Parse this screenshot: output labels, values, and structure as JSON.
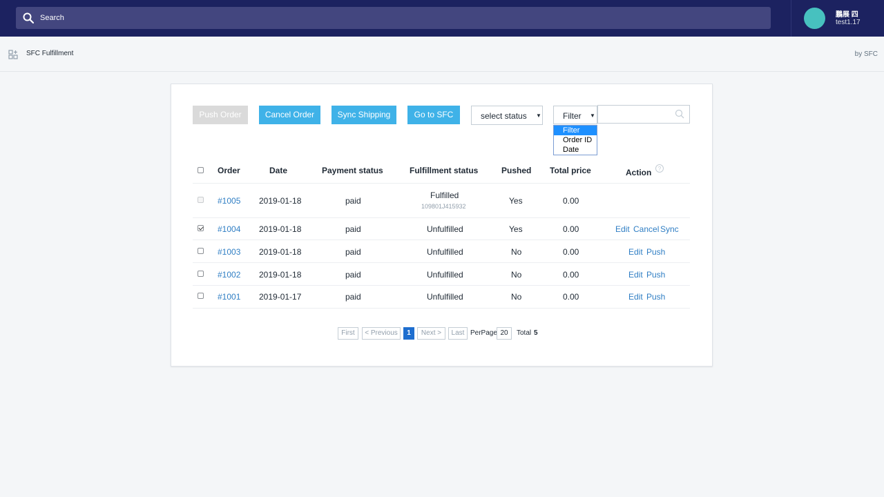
{
  "topbar": {
    "search_placeholder": "Search",
    "user_name": "鵬展 四",
    "shop_name": "test1.17",
    "colors": {
      "bar": "#1c2260",
      "search": "#43467f",
      "avatar": "#47c1bf"
    }
  },
  "app": {
    "title": "SFC Fulfillment",
    "by": "by SFC"
  },
  "toolbar": {
    "push_order": "Push Order",
    "cancel_order": "Cancel Order",
    "sync_shipping": "Sync Shipping",
    "go_to_sfc": "Go to SFC",
    "status_select": "select status",
    "filter_select": "Filter",
    "filter_options": [
      "Filter",
      "Order ID",
      "Date"
    ],
    "accent": "#3fb2e8"
  },
  "table": {
    "headers": {
      "order": "Order",
      "date": "Date",
      "payment": "Payment status",
      "fulfillment": "Fulfillment status",
      "pushed": "Pushed",
      "total": "Total price",
      "action": "Action"
    },
    "rows": [
      {
        "order": "#1005",
        "date": "2019-01-18",
        "payment": "paid",
        "fulfillment": "Fulfilled",
        "tracking": "109801J415932",
        "pushed": "Yes",
        "total": "0.00",
        "checked": false,
        "disabled": true,
        "actions": []
      },
      {
        "order": "#1004",
        "date": "2019-01-18",
        "payment": "paid",
        "fulfillment": "Unfulfilled",
        "tracking": "",
        "pushed": "Yes",
        "total": "0.00",
        "checked": true,
        "disabled": false,
        "actions": [
          "Edit",
          "Cancel",
          "Sync"
        ]
      },
      {
        "order": "#1003",
        "date": "2019-01-18",
        "payment": "paid",
        "fulfillment": "Unfulfilled",
        "tracking": "",
        "pushed": "No",
        "total": "0.00",
        "checked": false,
        "disabled": false,
        "actions": [
          "Edit",
          "Push"
        ]
      },
      {
        "order": "#1002",
        "date": "2019-01-18",
        "payment": "paid",
        "fulfillment": "Unfulfilled",
        "tracking": "",
        "pushed": "No",
        "total": "0.00",
        "checked": false,
        "disabled": false,
        "actions": [
          "Edit",
          "Push"
        ]
      },
      {
        "order": "#1001",
        "date": "2019-01-17",
        "payment": "paid",
        "fulfillment": "Unfulfilled",
        "tracking": "",
        "pushed": "No",
        "total": "0.00",
        "checked": false,
        "disabled": false,
        "actions": [
          "Edit",
          "Push"
        ]
      }
    ]
  },
  "pagination": {
    "first": "First",
    "previous": "< Previous",
    "current": "1",
    "next": "Next >",
    "last": "Last",
    "per_page_label": "PerPage",
    "per_page": "20",
    "total_label": "Total",
    "total": "5"
  }
}
